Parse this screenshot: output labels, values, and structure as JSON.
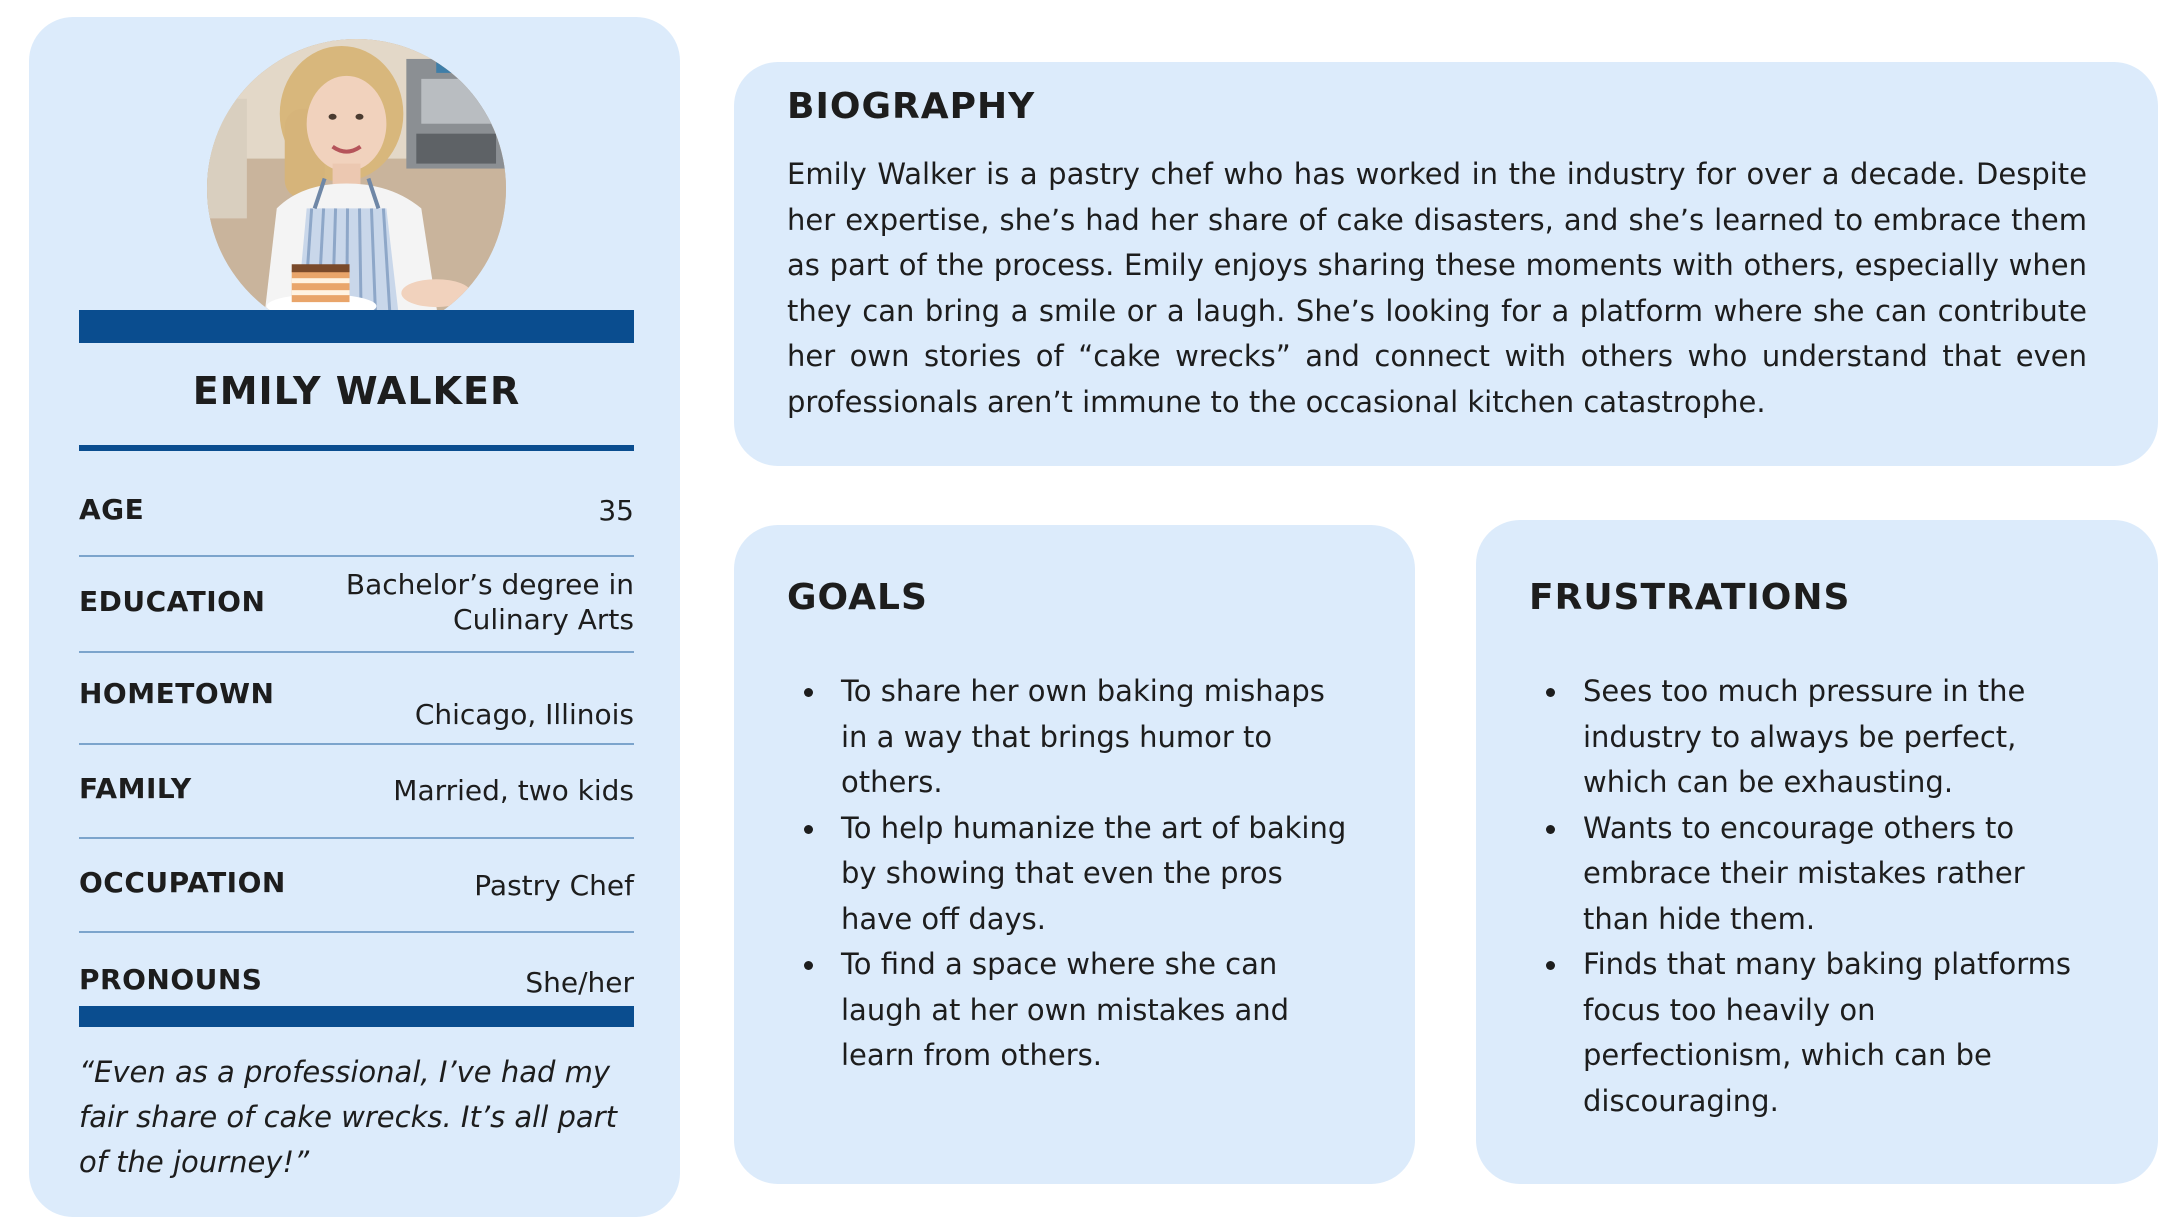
{
  "profile": {
    "avatar_alt": "Photo of a smiling pastry chef in a striped apron holding a slice of layered cake",
    "name": "EMILY WALKER",
    "attributes": [
      {
        "label": "AGE",
        "value": "35"
      },
      {
        "label": "EDUCATION",
        "value": "Bachelor’s degree in Culinary Arts"
      },
      {
        "label": "HOMETOWN",
        "value": "Chicago, Illinois"
      },
      {
        "label": "FAMILY",
        "value": "Married, two kids"
      },
      {
        "label": "OCCUPATION",
        "value": "Pastry Chef"
      },
      {
        "label": "PRONOUNS",
        "value": "She/her"
      }
    ],
    "quote": "“Even as a professional, I’ve had my fair share of cake wrecks. It’s all part of the journey!”"
  },
  "biography": {
    "title": "BIOGRAPHY",
    "text": "Emily Walker is a pastry chef who has worked in the industry for over a decade. Despite her expertise, she’s had her share of cake disasters, and she’s learned to embrace them as part of the process. Emily enjoys sharing these moments with others, especially when they can bring a smile or a laugh. She’s looking for a platform where she can contribute her own stories of “cake wrecks” and connect with others who understand that even professionals aren’t immune to the occasional kitchen catastrophe."
  },
  "goals": {
    "title": "GOALS",
    "items": [
      "To share her own baking mishaps in a way that brings humor to others.",
      "To help humanize the art of baking by showing that even the pros have off days.",
      "To find a space where she can laugh at her own mistakes and learn from others."
    ]
  },
  "frustrations": {
    "title": "FRUSTRATIONS",
    "items": [
      "Sees too much pressure in the industry to always be perfect, which can be exhausting.",
      "Wants to encourage others to embrace their mistakes rather than hide them.",
      "Finds that many baking platforms focus too heavily on perfectionism, which can be discouraging."
    ]
  },
  "colors": {
    "card_background": "#dcebfb",
    "accent_bar": "#0a4d8f",
    "row_divider": "#7ca4cc",
    "text": "#1d1d1d"
  }
}
